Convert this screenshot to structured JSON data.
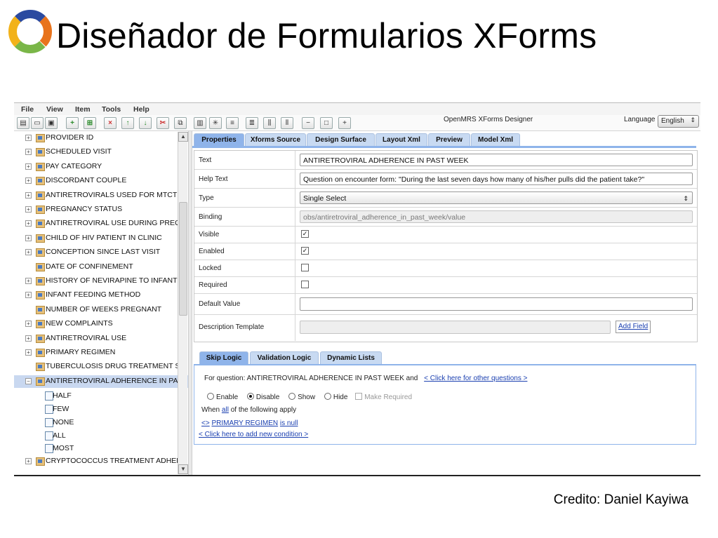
{
  "slide": {
    "title": "Diseñador de Formularios XForms",
    "credit": "Credito: Daniel Kayiwa"
  },
  "app": {
    "menu": [
      "File",
      "View",
      "Item",
      "Tools",
      "Help"
    ],
    "title": "OpenMRS XForms Designer",
    "language_label": "Language",
    "language_value": "English"
  },
  "toolbar_icons": [
    "new-form-icon",
    "open-icon",
    "save-icon",
    "add-icon",
    "add-child-icon",
    "delete-icon",
    "move-up-icon",
    "move-down-icon",
    "cut-icon",
    "copy-icon",
    "paste-icon",
    "refresh-icon",
    "align-left-icon",
    "align-right-icon",
    "align-top-icon",
    "align-bottom-icon",
    "collapse-icon",
    "view-icon",
    "expand-icon"
  ],
  "tree": {
    "items": [
      {
        "label": "PROVIDER ID",
        "expandable": true
      },
      {
        "label": "SCHEDULED VISIT",
        "expandable": true
      },
      {
        "label": "PAY CATEGORY",
        "expandable": true
      },
      {
        "label": "DISCORDANT COUPLE",
        "expandable": true
      },
      {
        "label": "ANTIRETROVIRALS USED FOR MTCT P",
        "expandable": true
      },
      {
        "label": "PREGNANCY STATUS",
        "expandable": true
      },
      {
        "label": "ANTIRETROVIRAL USE DURING PREGI",
        "expandable": true
      },
      {
        "label": "CHILD OF HIV PATIENT IN CLINIC",
        "expandable": true
      },
      {
        "label": "CONCEPTION SINCE LAST VISIT",
        "expandable": true
      },
      {
        "label": "DATE OF CONFINEMENT",
        "expandable": false
      },
      {
        "label": "HISTORY OF NEVIRAPINE TO INFANT",
        "expandable": true
      },
      {
        "label": "INFANT FEEDING METHOD",
        "expandable": true
      },
      {
        "label": "NUMBER OF WEEKS PREGNANT",
        "expandable": false
      },
      {
        "label": "NEW COMPLAINTS",
        "expandable": true
      },
      {
        "label": "ANTIRETROVIRAL USE",
        "expandable": true
      },
      {
        "label": "PRIMARY REGIMEN",
        "expandable": true
      },
      {
        "label": "TUBERCULOSIS DRUG TREATMENT ST",
        "expandable": false
      },
      {
        "label": "ANTIRETROVIRAL ADHERENCE IN PAS",
        "expandable": true,
        "expanded": true,
        "selected": true
      }
    ],
    "children": [
      "HALF",
      "FEW",
      "NONE",
      "ALL",
      "MOST"
    ],
    "last_item": "CRYPTOCOCCUS TREATMENT ADHER"
  },
  "tabs": [
    "Properties",
    "Xforms Source",
    "Design Surface",
    "Layout Xml",
    "Preview",
    "Model Xml"
  ],
  "properties": {
    "text_label": "Text",
    "text_value": "ANTIRETROVIRAL ADHERENCE IN PAST WEEK",
    "help_label": "Help Text",
    "help_value": "Question on encounter form: \"During the last seven days how many of his/her pulls did the patient take?\"",
    "type_label": "Type",
    "type_value": "Single Select",
    "binding_label": "Binding",
    "binding_value": "obs/antiretroviral_adherence_in_past_week/value",
    "visible_label": "Visible",
    "visible": true,
    "enabled_label": "Enabled",
    "enabled": true,
    "locked_label": "Locked",
    "locked": false,
    "required_label": "Required",
    "required": false,
    "default_label": "Default Value",
    "default_value": "",
    "desc_label": "Description Template",
    "desc_value": "",
    "add_field": "Add Field"
  },
  "lower_tabs": [
    "Skip Logic",
    "Validation Logic",
    "Dynamic Lists"
  ],
  "skip_logic": {
    "for_question_prefix": "For question: ANTIRETROVIRAL ADHERENCE IN PAST WEEK  and",
    "other_questions_link": "< Click here for other questions >",
    "options": [
      "Enable",
      "Disable",
      "Show",
      "Hide"
    ],
    "selected_option": "Disable",
    "make_required": "Make Required",
    "when_prefix": "When",
    "when_all": "all",
    "when_suffix": "of the following apply",
    "cond_op": "<>",
    "cond_field": "PRIMARY REGIMEN",
    "cond_value": "is null",
    "add_condition": "< Click here to add new condition >"
  },
  "colors": {
    "tab_active": "#8fb4ea",
    "tab": "#c8daf2",
    "link": "#1a3fb0",
    "logo_orange": "#e8731c",
    "logo_blue": "#2b4aa0",
    "logo_yellow": "#f2b21a",
    "logo_green": "#7ab648"
  }
}
